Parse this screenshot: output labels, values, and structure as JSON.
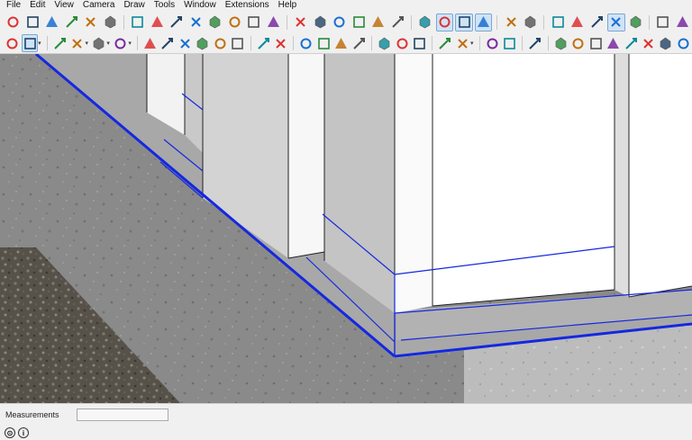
{
  "menu": [
    "File",
    "Edit",
    "View",
    "Camera",
    "Draw",
    "Tools",
    "Window",
    "Extensions",
    "Help"
  ],
  "toolbar_row1": [
    {
      "icon": "dropper-icon"
    },
    {
      "icon": "component-select-icon"
    },
    {
      "icon": "follow-me-icon"
    },
    {
      "icon": "dimension-icon"
    },
    {
      "icon": "axes-icon"
    },
    {
      "icon": "text-a-icon"
    },
    {
      "sep": true
    },
    {
      "icon": "section-plane-icon"
    },
    {
      "icon": "walk-icon"
    },
    {
      "icon": "zoom-icon"
    },
    {
      "icon": "zoom-window-icon"
    },
    {
      "icon": "zoom-extents-icon"
    },
    {
      "icon": "previous-view-icon"
    },
    {
      "icon": "position-camera-icon"
    },
    {
      "icon": "look-around-icon"
    },
    {
      "sep": true
    },
    {
      "icon": "iso-view-icon"
    },
    {
      "icon": "top-view-icon"
    },
    {
      "icon": "front-view-icon"
    },
    {
      "icon": "right-view-icon"
    },
    {
      "icon": "back-view-icon"
    },
    {
      "icon": "left-view-icon"
    },
    {
      "sep": true
    },
    {
      "icon": "xray-icon"
    },
    {
      "icon": "back-edges-icon",
      "active": true
    },
    {
      "icon": "wireframe-icon",
      "active": true
    },
    {
      "icon": "hidden-line-icon",
      "active": true
    },
    {
      "sep": true
    },
    {
      "icon": "shaded-icon"
    },
    {
      "icon": "shaded-textures-icon"
    },
    {
      "sep": true
    },
    {
      "icon": "monochrome-icon"
    },
    {
      "icon": "box-icon"
    },
    {
      "icon": "solid-box-icon"
    },
    {
      "icon": "textured-box-icon",
      "active": true
    },
    {
      "icon": "style-box-icon"
    },
    {
      "sep": true
    },
    {
      "icon": "orbit-icon"
    },
    {
      "icon": "pan-refresh-icon"
    }
  ],
  "toolbar_row2": [
    {
      "icon": "search-icon"
    },
    {
      "icon": "select-arrow-icon",
      "active": true,
      "dropdown": true
    },
    {
      "sep": true
    },
    {
      "icon": "eraser-icon"
    },
    {
      "icon": "pencil-icon",
      "dropdown": true
    },
    {
      "icon": "arc-icon",
      "dropdown": true
    },
    {
      "icon": "rectangle-icon",
      "dropdown": true
    },
    {
      "sep": true
    },
    {
      "icon": "push-pull-icon"
    },
    {
      "icon": "offset-icon"
    },
    {
      "icon": "move-icon"
    },
    {
      "icon": "rotate-icon"
    },
    {
      "icon": "scale-icon"
    },
    {
      "icon": "triangle-warning-icon"
    },
    {
      "sep": true
    },
    {
      "icon": "paint-bucket-icon"
    },
    {
      "icon": "tape-measure-icon"
    },
    {
      "sep": true
    },
    {
      "icon": "section-icon"
    },
    {
      "icon": "walk-person-icon"
    },
    {
      "icon": "magnifier-icon"
    },
    {
      "icon": "zoom-fit-icon"
    },
    {
      "sep": true
    },
    {
      "icon": "sandbox-icon"
    },
    {
      "icon": "sandbox-drape-icon"
    },
    {
      "icon": "layers-icon"
    },
    {
      "sep": true
    },
    {
      "icon": "outliner-icon"
    },
    {
      "icon": "geo-location-icon",
      "dropdown": true
    },
    {
      "sep": true
    },
    {
      "icon": "new-page-icon"
    },
    {
      "icon": "user-icon"
    },
    {
      "sep": true
    },
    {
      "icon": "material-icon"
    },
    {
      "sep": true
    },
    {
      "icon": "wand-icon"
    },
    {
      "icon": "measure-icon"
    },
    {
      "icon": "grad-cap-icon"
    },
    {
      "icon": "parcel-icon"
    },
    {
      "icon": "edit-tool-icon"
    },
    {
      "icon": "candelabra-icon"
    },
    {
      "icon": "extension-box-icon"
    },
    {
      "icon": "extension-gear-icon"
    }
  ],
  "statusbar": {
    "measurements_label": "Measurements",
    "measurements_value": "",
    "info_icon": "info-icon",
    "geo_icon": "geo-status-icon"
  },
  "viewport": {
    "description_colors": {
      "selection_edge": "#1a2bd6",
      "wall_face": "#ffffff",
      "wall_shadow": "#b5b5b5",
      "concrete_light": "#bdbdbd",
      "concrete_dark": "#7d7d7d",
      "gravel": "#6e6a60"
    }
  }
}
